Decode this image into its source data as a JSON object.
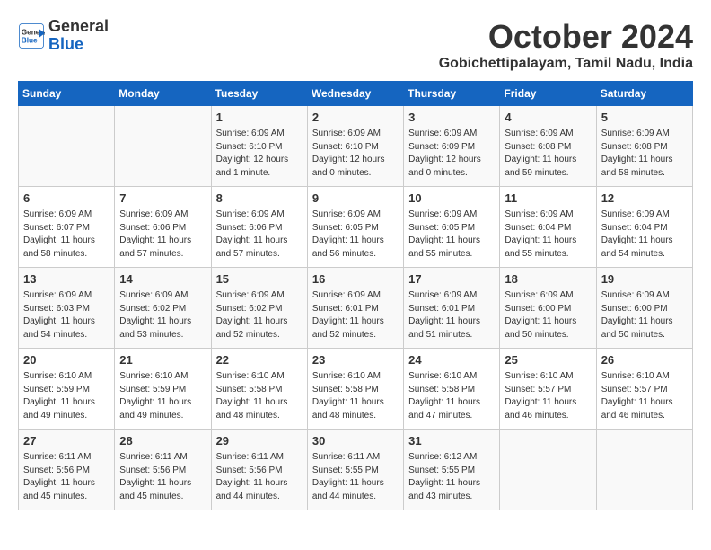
{
  "logo": {
    "line1": "General",
    "line2": "Blue"
  },
  "title": "October 2024",
  "location": "Gobichettipalayam, Tamil Nadu, India",
  "headers": [
    "Sunday",
    "Monday",
    "Tuesday",
    "Wednesday",
    "Thursday",
    "Friday",
    "Saturday"
  ],
  "weeks": [
    [
      {
        "day": "",
        "info": ""
      },
      {
        "day": "",
        "info": ""
      },
      {
        "day": "1",
        "info": "Sunrise: 6:09 AM\nSunset: 6:10 PM\nDaylight: 12 hours\nand 1 minute."
      },
      {
        "day": "2",
        "info": "Sunrise: 6:09 AM\nSunset: 6:10 PM\nDaylight: 12 hours\nand 0 minutes."
      },
      {
        "day": "3",
        "info": "Sunrise: 6:09 AM\nSunset: 6:09 PM\nDaylight: 12 hours\nand 0 minutes."
      },
      {
        "day": "4",
        "info": "Sunrise: 6:09 AM\nSunset: 6:08 PM\nDaylight: 11 hours\nand 59 minutes."
      },
      {
        "day": "5",
        "info": "Sunrise: 6:09 AM\nSunset: 6:08 PM\nDaylight: 11 hours\nand 58 minutes."
      }
    ],
    [
      {
        "day": "6",
        "info": "Sunrise: 6:09 AM\nSunset: 6:07 PM\nDaylight: 11 hours\nand 58 minutes."
      },
      {
        "day": "7",
        "info": "Sunrise: 6:09 AM\nSunset: 6:06 PM\nDaylight: 11 hours\nand 57 minutes."
      },
      {
        "day": "8",
        "info": "Sunrise: 6:09 AM\nSunset: 6:06 PM\nDaylight: 11 hours\nand 57 minutes."
      },
      {
        "day": "9",
        "info": "Sunrise: 6:09 AM\nSunset: 6:05 PM\nDaylight: 11 hours\nand 56 minutes."
      },
      {
        "day": "10",
        "info": "Sunrise: 6:09 AM\nSunset: 6:05 PM\nDaylight: 11 hours\nand 55 minutes."
      },
      {
        "day": "11",
        "info": "Sunrise: 6:09 AM\nSunset: 6:04 PM\nDaylight: 11 hours\nand 55 minutes."
      },
      {
        "day": "12",
        "info": "Sunrise: 6:09 AM\nSunset: 6:04 PM\nDaylight: 11 hours\nand 54 minutes."
      }
    ],
    [
      {
        "day": "13",
        "info": "Sunrise: 6:09 AM\nSunset: 6:03 PM\nDaylight: 11 hours\nand 54 minutes."
      },
      {
        "day": "14",
        "info": "Sunrise: 6:09 AM\nSunset: 6:02 PM\nDaylight: 11 hours\nand 53 minutes."
      },
      {
        "day": "15",
        "info": "Sunrise: 6:09 AM\nSunset: 6:02 PM\nDaylight: 11 hours\nand 52 minutes."
      },
      {
        "day": "16",
        "info": "Sunrise: 6:09 AM\nSunset: 6:01 PM\nDaylight: 11 hours\nand 52 minutes."
      },
      {
        "day": "17",
        "info": "Sunrise: 6:09 AM\nSunset: 6:01 PM\nDaylight: 11 hours\nand 51 minutes."
      },
      {
        "day": "18",
        "info": "Sunrise: 6:09 AM\nSunset: 6:00 PM\nDaylight: 11 hours\nand 50 minutes."
      },
      {
        "day": "19",
        "info": "Sunrise: 6:09 AM\nSunset: 6:00 PM\nDaylight: 11 hours\nand 50 minutes."
      }
    ],
    [
      {
        "day": "20",
        "info": "Sunrise: 6:10 AM\nSunset: 5:59 PM\nDaylight: 11 hours\nand 49 minutes."
      },
      {
        "day": "21",
        "info": "Sunrise: 6:10 AM\nSunset: 5:59 PM\nDaylight: 11 hours\nand 49 minutes."
      },
      {
        "day": "22",
        "info": "Sunrise: 6:10 AM\nSunset: 5:58 PM\nDaylight: 11 hours\nand 48 minutes."
      },
      {
        "day": "23",
        "info": "Sunrise: 6:10 AM\nSunset: 5:58 PM\nDaylight: 11 hours\nand 48 minutes."
      },
      {
        "day": "24",
        "info": "Sunrise: 6:10 AM\nSunset: 5:58 PM\nDaylight: 11 hours\nand 47 minutes."
      },
      {
        "day": "25",
        "info": "Sunrise: 6:10 AM\nSunset: 5:57 PM\nDaylight: 11 hours\nand 46 minutes."
      },
      {
        "day": "26",
        "info": "Sunrise: 6:10 AM\nSunset: 5:57 PM\nDaylight: 11 hours\nand 46 minutes."
      }
    ],
    [
      {
        "day": "27",
        "info": "Sunrise: 6:11 AM\nSunset: 5:56 PM\nDaylight: 11 hours\nand 45 minutes."
      },
      {
        "day": "28",
        "info": "Sunrise: 6:11 AM\nSunset: 5:56 PM\nDaylight: 11 hours\nand 45 minutes."
      },
      {
        "day": "29",
        "info": "Sunrise: 6:11 AM\nSunset: 5:56 PM\nDaylight: 11 hours\nand 44 minutes."
      },
      {
        "day": "30",
        "info": "Sunrise: 6:11 AM\nSunset: 5:55 PM\nDaylight: 11 hours\nand 44 minutes."
      },
      {
        "day": "31",
        "info": "Sunrise: 6:12 AM\nSunset: 5:55 PM\nDaylight: 11 hours\nand 43 minutes."
      },
      {
        "day": "",
        "info": ""
      },
      {
        "day": "",
        "info": ""
      }
    ]
  ]
}
